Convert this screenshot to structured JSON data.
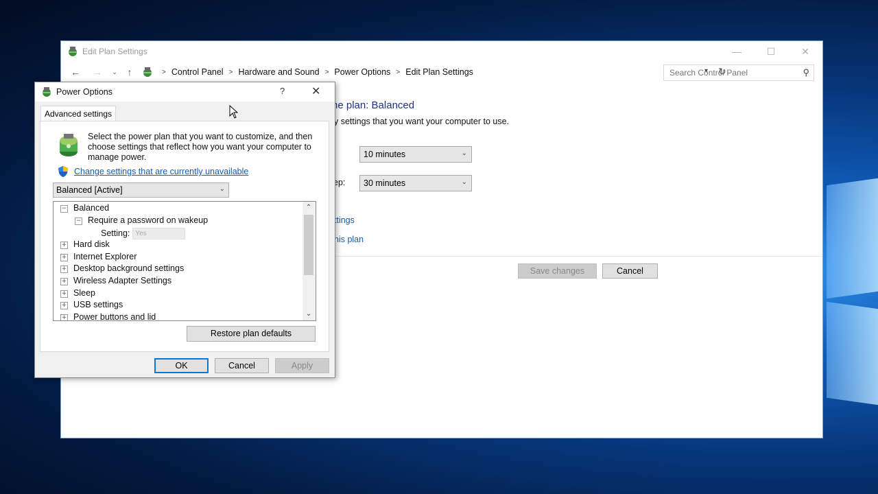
{
  "control_panel": {
    "window_title": "Edit Plan Settings",
    "window_controls": {
      "minimize": "—",
      "maximize": "☐",
      "close": "✕"
    },
    "breadcrumb": [
      "Control Panel",
      "Hardware and Sound",
      "Power Options",
      "Edit Plan Settings"
    ],
    "search_placeholder": "Search Control Panel",
    "heading": "he plan: Balanced",
    "subheading": "y settings that you want your computer to use.",
    "display_off": "10 minutes",
    "sleep_label": "ep:",
    "sleep_value": "30 minutes",
    "link_advanced": "ttings",
    "link_restore": "his plan",
    "save_button": "Save changes",
    "cancel_button": "Cancel"
  },
  "dialog": {
    "title": "Power Options",
    "help": "?",
    "close": "✕",
    "tab": "Advanced settings",
    "description": "Select the power plan that you want to customize, and then choose settings that reflect how you want your computer to manage power.",
    "change_link": "Change settings that are currently unavailable",
    "plan_selected": "Balanced [Active]",
    "tree": {
      "root": "Balanced",
      "child": "Require a password on wakeup",
      "setting_label": "Setting:",
      "setting_value": "Yes",
      "items": [
        "Hard disk",
        "Internet Explorer",
        "Desktop background settings",
        "Wireless Adapter Settings",
        "Sleep",
        "USB settings",
        "Power buttons and lid"
      ]
    },
    "restore_button": "Restore plan defaults",
    "ok_button": "OK",
    "cancel_button": "Cancel",
    "apply_button": "Apply"
  }
}
